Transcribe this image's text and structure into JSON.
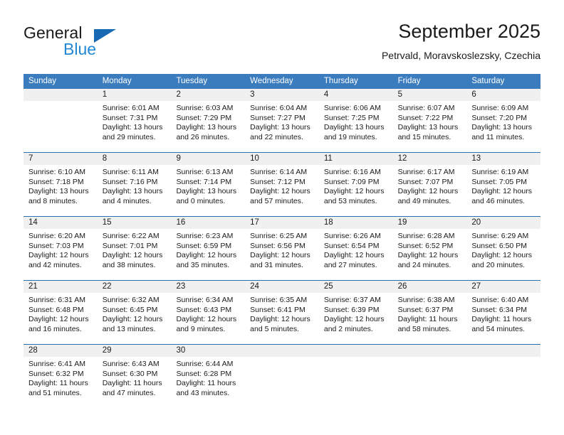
{
  "brand": {
    "line1": "General",
    "line2": "Blue",
    "logo_accent": "#1669b2",
    "logo_text_color": "#2288d6"
  },
  "header": {
    "title": "September 2025",
    "subtitle": "Petrvald, Moravskoslezsky, Czechia"
  },
  "calendar": {
    "header_bg": "#3a7cbe",
    "daynum_bg": "#f0f0f0",
    "weekdays": [
      "Sunday",
      "Monday",
      "Tuesday",
      "Wednesday",
      "Thursday",
      "Friday",
      "Saturday"
    ],
    "weeks": [
      [
        {
          "day": "",
          "lines": []
        },
        {
          "day": "1",
          "lines": [
            "Sunrise: 6:01 AM",
            "Sunset: 7:31 PM",
            "Daylight: 13 hours",
            "and 29 minutes."
          ]
        },
        {
          "day": "2",
          "lines": [
            "Sunrise: 6:03 AM",
            "Sunset: 7:29 PM",
            "Daylight: 13 hours",
            "and 26 minutes."
          ]
        },
        {
          "day": "3",
          "lines": [
            "Sunrise: 6:04 AM",
            "Sunset: 7:27 PM",
            "Daylight: 13 hours",
            "and 22 minutes."
          ]
        },
        {
          "day": "4",
          "lines": [
            "Sunrise: 6:06 AM",
            "Sunset: 7:25 PM",
            "Daylight: 13 hours",
            "and 19 minutes."
          ]
        },
        {
          "day": "5",
          "lines": [
            "Sunrise: 6:07 AM",
            "Sunset: 7:22 PM",
            "Daylight: 13 hours",
            "and 15 minutes."
          ]
        },
        {
          "day": "6",
          "lines": [
            "Sunrise: 6:09 AM",
            "Sunset: 7:20 PM",
            "Daylight: 13 hours",
            "and 11 minutes."
          ]
        }
      ],
      [
        {
          "day": "7",
          "lines": [
            "Sunrise: 6:10 AM",
            "Sunset: 7:18 PM",
            "Daylight: 13 hours",
            "and 8 minutes."
          ]
        },
        {
          "day": "8",
          "lines": [
            "Sunrise: 6:11 AM",
            "Sunset: 7:16 PM",
            "Daylight: 13 hours",
            "and 4 minutes."
          ]
        },
        {
          "day": "9",
          "lines": [
            "Sunrise: 6:13 AM",
            "Sunset: 7:14 PM",
            "Daylight: 13 hours",
            "and 0 minutes."
          ]
        },
        {
          "day": "10",
          "lines": [
            "Sunrise: 6:14 AM",
            "Sunset: 7:12 PM",
            "Daylight: 12 hours",
            "and 57 minutes."
          ]
        },
        {
          "day": "11",
          "lines": [
            "Sunrise: 6:16 AM",
            "Sunset: 7:09 PM",
            "Daylight: 12 hours",
            "and 53 minutes."
          ]
        },
        {
          "day": "12",
          "lines": [
            "Sunrise: 6:17 AM",
            "Sunset: 7:07 PM",
            "Daylight: 12 hours",
            "and 49 minutes."
          ]
        },
        {
          "day": "13",
          "lines": [
            "Sunrise: 6:19 AM",
            "Sunset: 7:05 PM",
            "Daylight: 12 hours",
            "and 46 minutes."
          ]
        }
      ],
      [
        {
          "day": "14",
          "lines": [
            "Sunrise: 6:20 AM",
            "Sunset: 7:03 PM",
            "Daylight: 12 hours",
            "and 42 minutes."
          ]
        },
        {
          "day": "15",
          "lines": [
            "Sunrise: 6:22 AM",
            "Sunset: 7:01 PM",
            "Daylight: 12 hours",
            "and 38 minutes."
          ]
        },
        {
          "day": "16",
          "lines": [
            "Sunrise: 6:23 AM",
            "Sunset: 6:59 PM",
            "Daylight: 12 hours",
            "and 35 minutes."
          ]
        },
        {
          "day": "17",
          "lines": [
            "Sunrise: 6:25 AM",
            "Sunset: 6:56 PM",
            "Daylight: 12 hours",
            "and 31 minutes."
          ]
        },
        {
          "day": "18",
          "lines": [
            "Sunrise: 6:26 AM",
            "Sunset: 6:54 PM",
            "Daylight: 12 hours",
            "and 27 minutes."
          ]
        },
        {
          "day": "19",
          "lines": [
            "Sunrise: 6:28 AM",
            "Sunset: 6:52 PM",
            "Daylight: 12 hours",
            "and 24 minutes."
          ]
        },
        {
          "day": "20",
          "lines": [
            "Sunrise: 6:29 AM",
            "Sunset: 6:50 PM",
            "Daylight: 12 hours",
            "and 20 minutes."
          ]
        }
      ],
      [
        {
          "day": "21",
          "lines": [
            "Sunrise: 6:31 AM",
            "Sunset: 6:48 PM",
            "Daylight: 12 hours",
            "and 16 minutes."
          ]
        },
        {
          "day": "22",
          "lines": [
            "Sunrise: 6:32 AM",
            "Sunset: 6:45 PM",
            "Daylight: 12 hours",
            "and 13 minutes."
          ]
        },
        {
          "day": "23",
          "lines": [
            "Sunrise: 6:34 AM",
            "Sunset: 6:43 PM",
            "Daylight: 12 hours",
            "and 9 minutes."
          ]
        },
        {
          "day": "24",
          "lines": [
            "Sunrise: 6:35 AM",
            "Sunset: 6:41 PM",
            "Daylight: 12 hours",
            "and 5 minutes."
          ]
        },
        {
          "day": "25",
          "lines": [
            "Sunrise: 6:37 AM",
            "Sunset: 6:39 PM",
            "Daylight: 12 hours",
            "and 2 minutes."
          ]
        },
        {
          "day": "26",
          "lines": [
            "Sunrise: 6:38 AM",
            "Sunset: 6:37 PM",
            "Daylight: 11 hours",
            "and 58 minutes."
          ]
        },
        {
          "day": "27",
          "lines": [
            "Sunrise: 6:40 AM",
            "Sunset: 6:34 PM",
            "Daylight: 11 hours",
            "and 54 minutes."
          ]
        }
      ],
      [
        {
          "day": "28",
          "lines": [
            "Sunrise: 6:41 AM",
            "Sunset: 6:32 PM",
            "Daylight: 11 hours",
            "and 51 minutes."
          ]
        },
        {
          "day": "29",
          "lines": [
            "Sunrise: 6:43 AM",
            "Sunset: 6:30 PM",
            "Daylight: 11 hours",
            "and 47 minutes."
          ]
        },
        {
          "day": "30",
          "lines": [
            "Sunrise: 6:44 AM",
            "Sunset: 6:28 PM",
            "Daylight: 11 hours",
            "and 43 minutes."
          ]
        },
        {
          "day": "",
          "lines": []
        },
        {
          "day": "",
          "lines": []
        },
        {
          "day": "",
          "lines": []
        },
        {
          "day": "",
          "lines": []
        }
      ]
    ]
  }
}
